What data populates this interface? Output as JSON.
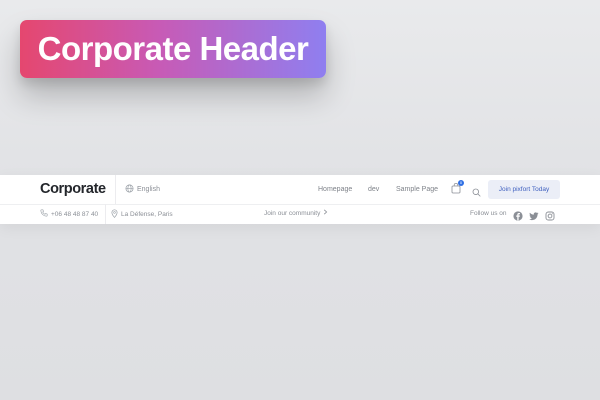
{
  "hero": {
    "title": "Corporate Header"
  },
  "header": {
    "logo": "Corporate",
    "language": "English",
    "nav": [
      "Homepage",
      "dev",
      "Sample Page"
    ],
    "cart_count": "0",
    "cta_label": "Join pixfort Today"
  },
  "topbar": {
    "phone": "+06 48 48 87 40",
    "location": "La Défense, Paris",
    "community_label": "Join our community",
    "follow_label": "Follow us on",
    "social": [
      "facebook-icon",
      "twitter-icon",
      "instagram-icon"
    ]
  },
  "colors": {
    "gradient_start": "#e5476f",
    "gradient_end": "#8f7ff0",
    "cta_text": "#3e5fbf",
    "cta_bg": "#ebeef7",
    "badge": "#2f6fe4"
  }
}
